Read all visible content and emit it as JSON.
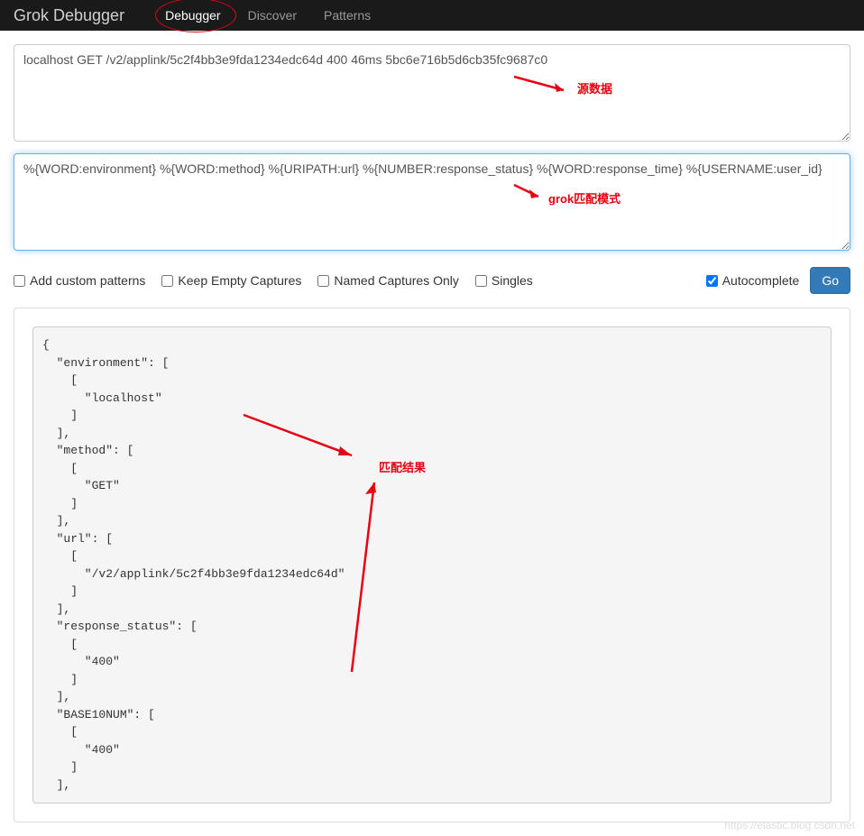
{
  "navbar": {
    "brand": "Grok Debugger",
    "tabs": [
      {
        "label": "Debugger",
        "active": true
      },
      {
        "label": "Discover",
        "active": false
      },
      {
        "label": "Patterns",
        "active": false
      }
    ]
  },
  "inputs": {
    "source_data": "localhost GET /v2/applink/5c2f4bb3e9fda1234edc64d 400 46ms 5bc6e716b5d6cb35fc9687c0",
    "grok_pattern": "%{WORD:environment} %{WORD:method} %{URIPATH:url} %{NUMBER:response_status} %{WORD:response_time} %{USERNAME:user_id}"
  },
  "controls": {
    "add_custom_patterns": "Add custom patterns",
    "keep_empty_captures": "Keep Empty Captures",
    "named_captures_only": "Named Captures Only",
    "singles": "Singles",
    "autocomplete": "Autocomplete",
    "go_button": "Go"
  },
  "annotations": {
    "source_label": "源数据",
    "pattern_label": "grok匹配模式",
    "result_label": "匹配结果"
  },
  "result": {
    "json_output": "{\n  \"environment\": [\n    [\n      \"localhost\"\n    ]\n  ],\n  \"method\": [\n    [\n      \"GET\"\n    ]\n  ],\n  \"url\": [\n    [\n      \"/v2/applink/5c2f4bb3e9fda1234edc64d\"\n    ]\n  ],\n  \"response_status\": [\n    [\n      \"400\"\n    ]\n  ],\n  \"BASE10NUM\": [\n    [\n      \"400\"\n    ]\n  ],"
  },
  "watermark": "https://elastic.blog.csdn.net"
}
